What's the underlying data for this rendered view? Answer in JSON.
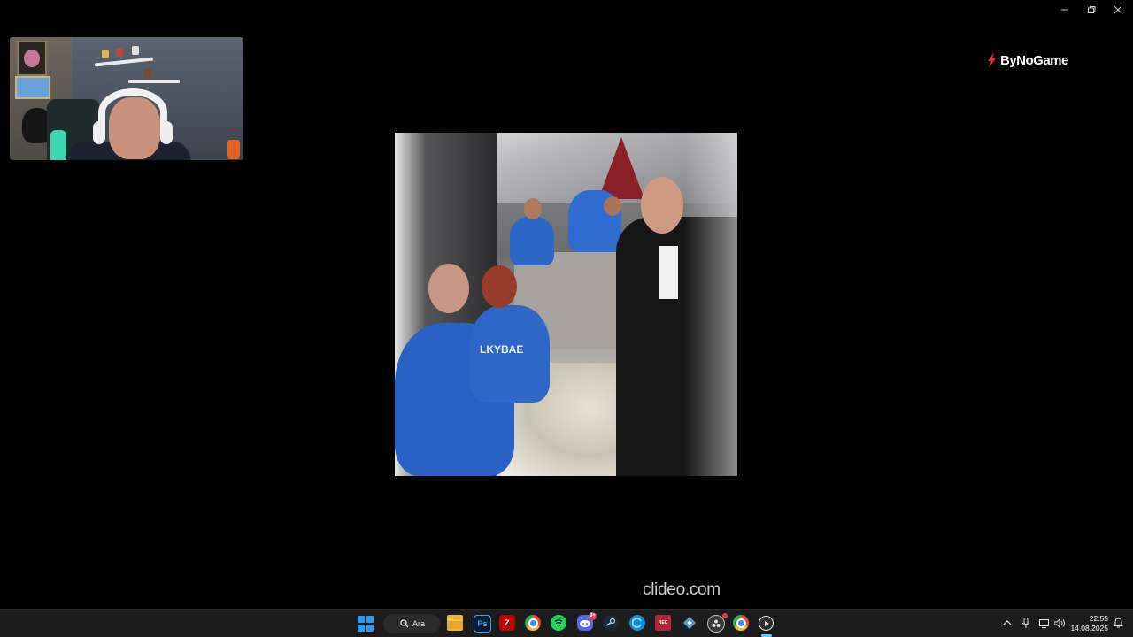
{
  "window": {
    "minimize_icon": "minimize-icon",
    "restore_icon": "restore-icon",
    "close_icon": "close-icon"
  },
  "logo": {
    "text": "ByNoGame",
    "mark_color": "#e8322a"
  },
  "watermark": {
    "text": "clideo.com"
  },
  "video_overlay": {
    "text": "LKYBAE"
  },
  "taskbar": {
    "search_label": "Ara",
    "apps": [
      {
        "name": "file-explorer",
        "icon": "folder-icon",
        "color": "#f2b636"
      },
      {
        "name": "photoshop",
        "icon": "photoshop-icon",
        "label": "Ps",
        "color": "#0b1a2e"
      },
      {
        "name": "filezilla",
        "icon": "filezilla-icon",
        "color": "#bf0000"
      },
      {
        "name": "chrome",
        "icon": "chrome-icon",
        "color": "#e8453c"
      },
      {
        "name": "spotify",
        "icon": "spotify-icon",
        "color": "#1ed760"
      },
      {
        "name": "discord",
        "icon": "discord-icon",
        "color": "#5865f2",
        "badge": "9+"
      },
      {
        "name": "steam",
        "icon": "steam-icon",
        "color": "#1b2838"
      },
      {
        "name": "edge",
        "icon": "browser-icon",
        "color": "#1487d6"
      },
      {
        "name": "stream-tool",
        "icon": "app-icon",
        "color": "#b3263a"
      },
      {
        "name": "app",
        "icon": "app-icon",
        "color": "#4f9bd9"
      },
      {
        "name": "obs",
        "icon": "obs-icon",
        "color": "#3a3a3a"
      },
      {
        "name": "chrome-2",
        "icon": "chrome-icon",
        "color": "#e8453c"
      },
      {
        "name": "media-player",
        "icon": "play-icon",
        "color": "#2b2b2b"
      }
    ]
  },
  "tray": {
    "chevron_icon": "chevron-up-icon",
    "mic_icon": "microphone-icon",
    "network_icon": "network-icon",
    "volume_icon": "volume-icon",
    "notification_icon": "notification-icon"
  },
  "clock": {
    "time": "22:55",
    "date": "14.08.2025"
  }
}
